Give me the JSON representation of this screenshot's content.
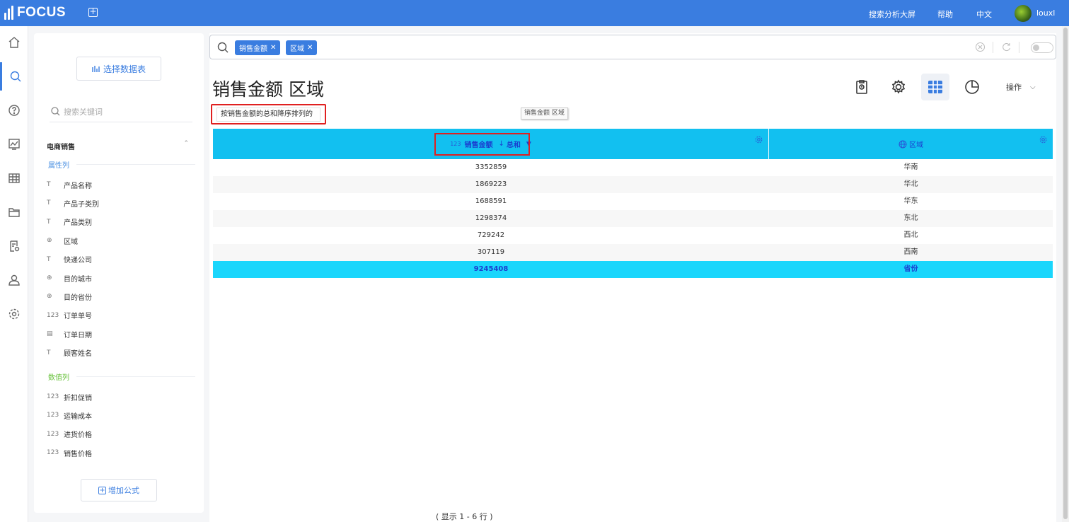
{
  "app": {
    "logo_text": "FOCUS"
  },
  "topbar": {
    "links": [
      "搜索分析大屏",
      "帮助",
      "中文"
    ],
    "username": "louxl"
  },
  "left_nav": [
    "home-icon",
    "search-icon",
    "help-icon",
    "chart-icon",
    "table-icon",
    "folder-icon",
    "report-settings-icon",
    "user-icon",
    "gear-icon"
  ],
  "panel": {
    "select_source_label": "选择数据表",
    "keyword_placeholder": "搜索关键词",
    "group_name": "电商销售",
    "attr_section": "属性列",
    "attr_fields": [
      {
        "icon": "text-type-icon",
        "glyph": "T",
        "name": "产品名称"
      },
      {
        "icon": "text-type-icon",
        "glyph": "T",
        "name": "产品子类别"
      },
      {
        "icon": "text-type-icon",
        "glyph": "T",
        "name": "产品类别"
      },
      {
        "icon": "globe-icon",
        "glyph": "⊕",
        "name": "区域"
      },
      {
        "icon": "text-type-icon",
        "glyph": "T",
        "name": "快递公司"
      },
      {
        "icon": "globe-icon",
        "glyph": "⊕",
        "name": "目的城市"
      },
      {
        "icon": "globe-icon",
        "glyph": "⊕",
        "name": "目的省份"
      },
      {
        "icon": "number-type-icon",
        "glyph": "123",
        "name": "订单单号"
      },
      {
        "icon": "calendar-icon",
        "glyph": "▤",
        "name": "订单日期"
      },
      {
        "icon": "text-type-icon",
        "glyph": "T",
        "name": "顾客姓名"
      }
    ],
    "num_section": "数值列",
    "num_fields": [
      {
        "glyph": "123",
        "name": "折扣促销"
      },
      {
        "glyph": "123",
        "name": "运输成本"
      },
      {
        "glyph": "123",
        "name": "进货价格"
      },
      {
        "glyph": "123",
        "name": "销售价格"
      }
    ],
    "add_formula_label": "增加公式"
  },
  "search": {
    "chips": [
      "销售金额",
      "区域"
    ]
  },
  "result": {
    "title": "销售金额 区域",
    "question": "按销售金额的总和降序排列的",
    "tooltip": "销售金额  区域",
    "ops_label": "操作"
  },
  "table": {
    "col1": {
      "type_badge": "123",
      "name": "销售金额",
      "sort": "↓",
      "agg": "总和"
    },
    "col2": {
      "name": "区域"
    },
    "rows": [
      [
        "3352859",
        "华南"
      ],
      [
        "1869223",
        "华北"
      ],
      [
        "1688591",
        "华东"
      ],
      [
        "1298374",
        "东北"
      ],
      [
        "729242",
        "西北"
      ],
      [
        "307119",
        "西南"
      ]
    ],
    "total": [
      "9245408",
      "省份"
    ],
    "footer": "( 显示 1 - 6 行 )"
  },
  "colors": {
    "brand": "#3a7de0",
    "header": "#12c0f0",
    "total_row": "#1ad6fc",
    "highlight": "#e02020"
  }
}
